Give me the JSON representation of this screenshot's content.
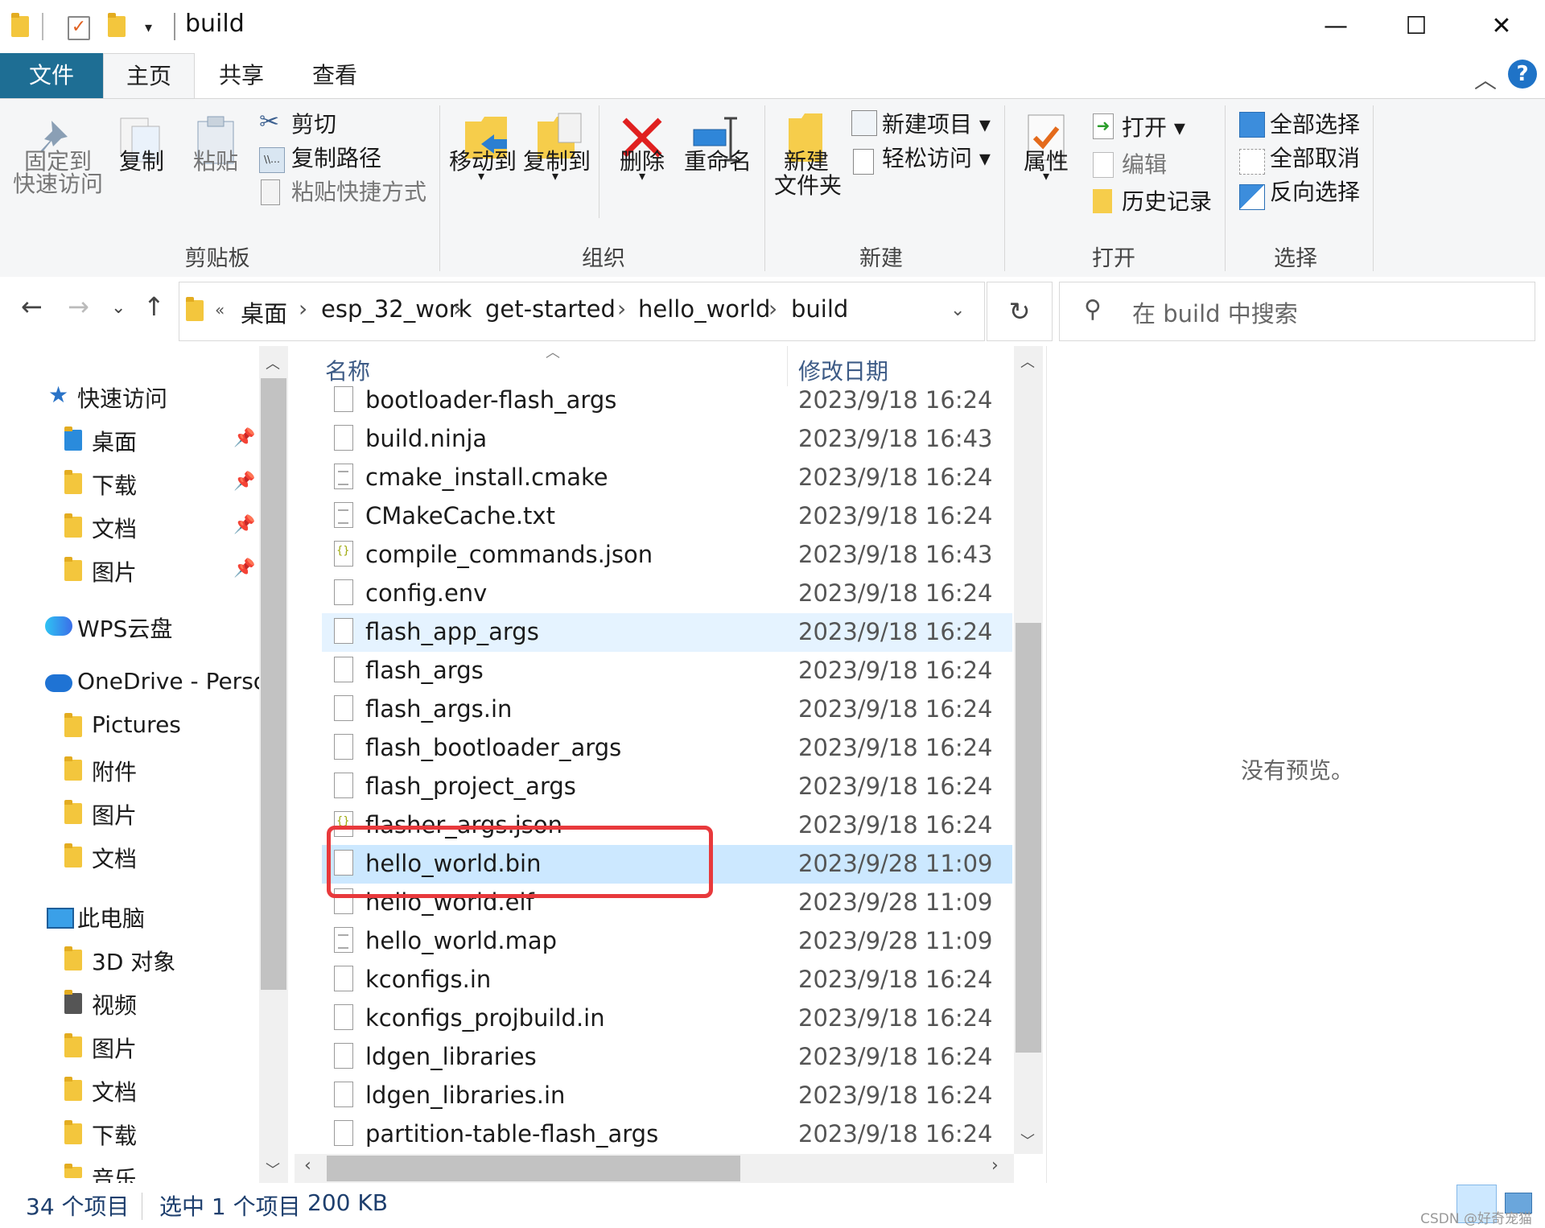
{
  "window": {
    "title": "build",
    "buttons": {
      "minimize": "—",
      "maximize": "☐",
      "close": "✕"
    }
  },
  "ribbon_tabs": [
    "文件",
    "主页",
    "共享",
    "查看"
  ],
  "ribbon": {
    "clipboard": {
      "title": "剪贴板",
      "pin_label_1": "固定到",
      "pin_label_2": "快速访问",
      "copy": "复制",
      "paste": "粘贴",
      "cut": "剪切",
      "copy_path": "复制路径",
      "paste_shortcut": "粘贴快捷方式"
    },
    "organize": {
      "title": "组织",
      "move_to": "移动到",
      "copy_to": "复制到",
      "delete": "删除",
      "rename": "重命名"
    },
    "new": {
      "title": "新建",
      "new_folder_1": "新建",
      "new_folder_2": "文件夹",
      "new_item": "新建项目 ▾",
      "easy_access": "轻松访问 ▾"
    },
    "open": {
      "title": "打开",
      "properties": "属性",
      "open": "打开 ▾",
      "edit": "编辑",
      "history": "历史记录"
    },
    "select": {
      "title": "选择",
      "select_all": "全部选择",
      "select_none": "全部取消",
      "invert": "反向选择"
    }
  },
  "address": {
    "overflow": "«",
    "crumbs": [
      "桌面",
      "esp_32_work",
      "get-started",
      "hello_world",
      "build"
    ],
    "search_placeholder": "在 build 中搜索"
  },
  "nav": {
    "quick_access": "快速访问",
    "quick_items": [
      "桌面",
      "下载",
      "文档",
      "图片"
    ],
    "wps": "WPS云盘",
    "onedrive": "OneDrive - Persor",
    "onedrive_items": [
      "Pictures",
      "附件",
      "图片",
      "文档"
    ],
    "this_pc": "此电脑",
    "pc_items": [
      "3D 对象",
      "视频",
      "图片",
      "文档",
      "下载",
      "音乐"
    ]
  },
  "columns": {
    "name": "名称",
    "date": "修改日期"
  },
  "files": [
    {
      "name": "bootloader-flash_args",
      "date": "2023/9/18 16:24",
      "icon": "file"
    },
    {
      "name": "build.ninja",
      "date": "2023/9/18 16:43",
      "icon": "file"
    },
    {
      "name": "cmake_install.cmake",
      "date": "2023/9/18 16:24",
      "icon": "text"
    },
    {
      "name": "CMakeCache.txt",
      "date": "2023/9/18 16:24",
      "icon": "text"
    },
    {
      "name": "compile_commands.json",
      "date": "2023/9/18 16:43",
      "icon": "json"
    },
    {
      "name": "config.env",
      "date": "2023/9/18 16:24",
      "icon": "file"
    },
    {
      "name": "flash_app_args",
      "date": "2023/9/18 16:24",
      "icon": "file",
      "state": "hover"
    },
    {
      "name": "flash_args",
      "date": "2023/9/18 16:24",
      "icon": "file"
    },
    {
      "name": "flash_args.in",
      "date": "2023/9/18 16:24",
      "icon": "file"
    },
    {
      "name": "flash_bootloader_args",
      "date": "2023/9/18 16:24",
      "icon": "file"
    },
    {
      "name": "flash_project_args",
      "date": "2023/9/18 16:24",
      "icon": "file"
    },
    {
      "name": "flasher_args.json",
      "date": "2023/9/18 16:24",
      "icon": "json"
    },
    {
      "name": "hello_world.bin",
      "date": "2023/9/28 11:09",
      "icon": "file",
      "state": "selected"
    },
    {
      "name": "hello_world.elf",
      "date": "2023/9/28 11:09",
      "icon": "file"
    },
    {
      "name": "hello_world.map",
      "date": "2023/9/28 11:09",
      "icon": "text"
    },
    {
      "name": "kconfigs.in",
      "date": "2023/9/18 16:24",
      "icon": "file"
    },
    {
      "name": "kconfigs_projbuild.in",
      "date": "2023/9/18 16:24",
      "icon": "file"
    },
    {
      "name": "ldgen_libraries",
      "date": "2023/9/18 16:24",
      "icon": "file"
    },
    {
      "name": "ldgen_libraries.in",
      "date": "2023/9/18 16:24",
      "icon": "file"
    },
    {
      "name": "partition-table-flash_args",
      "date": "2023/9/18 16:24",
      "icon": "file"
    }
  ],
  "preview": {
    "empty_text": "没有预览。"
  },
  "status": {
    "item_count": "34 个项目",
    "selected": "选中 1 个项目",
    "size": "200 KB"
  },
  "watermark": "CSDN @好奇宠猫",
  "colors": {
    "accent": "#1e6e94",
    "selection": "#cce8ff",
    "hover": "#e5f3ff",
    "highlight_box": "#e8393c"
  }
}
